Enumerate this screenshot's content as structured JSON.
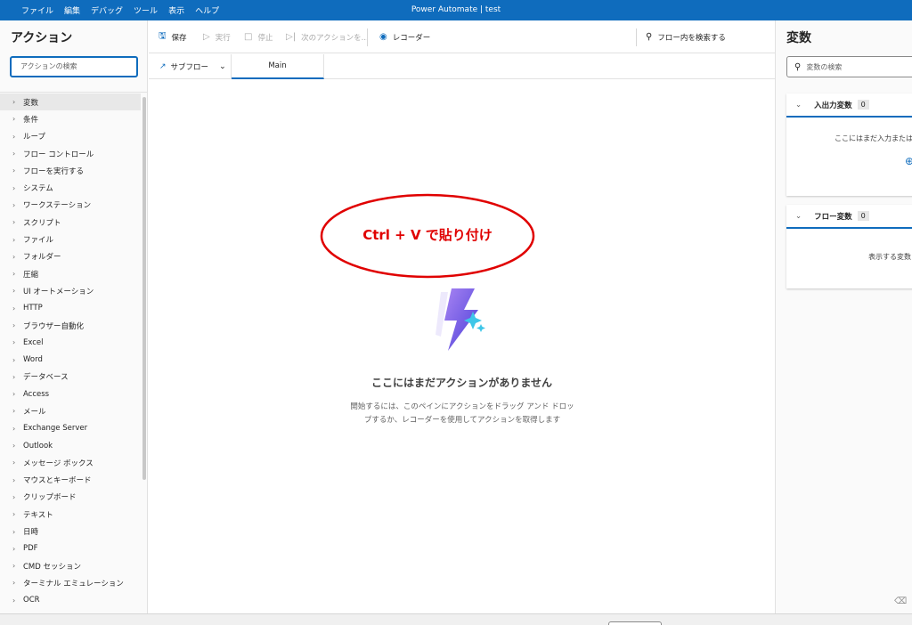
{
  "window": {
    "title": "Power Automate | test"
  },
  "menu": [
    "ファイル",
    "編集",
    "デバッグ",
    "ツール",
    "表示",
    "ヘルプ"
  ],
  "actions_pane": {
    "title": "アクション",
    "search_placeholder": "アクションの検索",
    "items": [
      "変数",
      "条件",
      "ループ",
      "フロー コントロール",
      "フローを実行する",
      "システム",
      "ワークステーション",
      "スクリプト",
      "ファイル",
      "フォルダー",
      "圧縮",
      "UI オートメーション",
      "HTTP",
      "ブラウザー自動化",
      "Excel",
      "Word",
      "データベース",
      "Access",
      "メール",
      "Exchange Server",
      "Outlook",
      "メッセージ ボックス",
      "マウスとキーボード",
      "クリップボード",
      "テキスト",
      "日時",
      "PDF",
      "CMD セッション",
      "ターミナル エミュレーション",
      "OCR"
    ]
  },
  "toolbar": {
    "save": "保存",
    "run": "実行",
    "stop": "停止",
    "next_action": "次のアクションを...",
    "recorder": "レコーダー",
    "search_flow": "フロー内を検索する"
  },
  "tabs": {
    "subflow": "サブフロー",
    "main": "Main"
  },
  "canvas": {
    "annotation": "Ctrl + V で貼り付け",
    "annotation_color": "#e00000",
    "empty_title": "ここにはまだアクションがありません",
    "empty_desc_line1": "開始するには、このペインにアクションをドラッグ アンド ドロッ",
    "empty_desc_line2": "プするか、レコーダーを使用してアクションを取得します"
  },
  "variables_pane": {
    "title": "変数",
    "search_placeholder": "変数の検索",
    "io_section": {
      "label": "入出力変数",
      "count": "0",
      "body": "ここにはまだ入力または出"
    },
    "flow_section": {
      "label": "フロー変数",
      "count": "0",
      "body": "表示する変数"
    }
  },
  "colors": {
    "accent": "#0f6cbd",
    "titlebar": "#0f6cbd"
  }
}
